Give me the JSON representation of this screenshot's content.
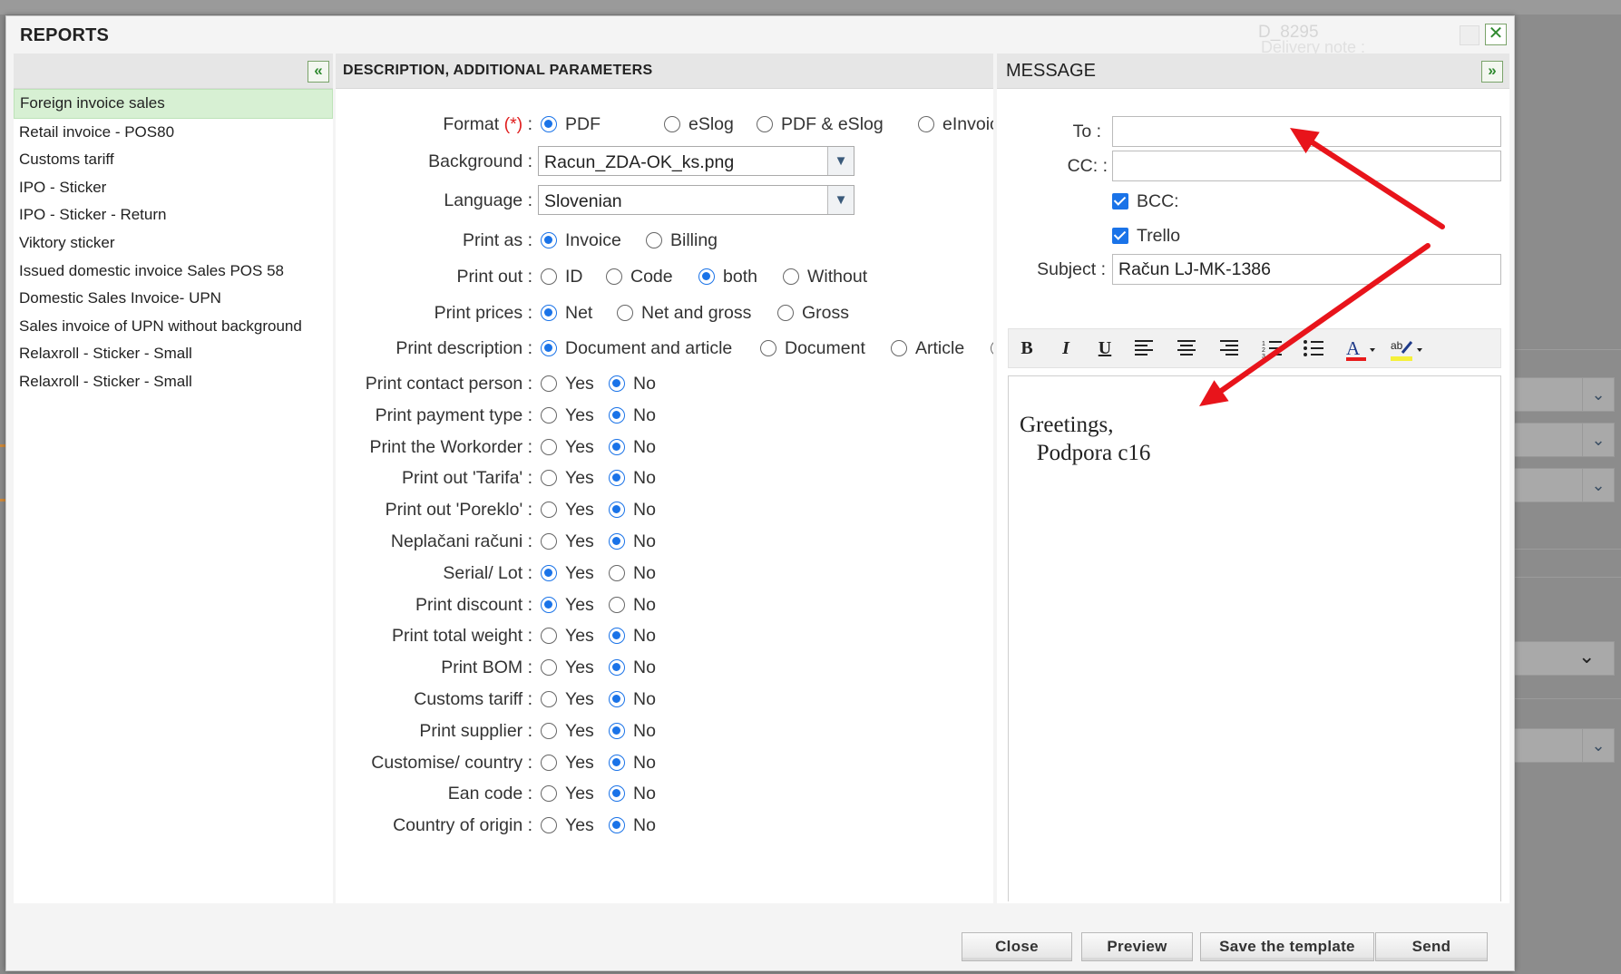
{
  "background_app": {
    "faded_code": "D_8295",
    "faded_label": "Delivery note :"
  },
  "dialog": {
    "title": "REPORTS",
    "close_icon": "close-icon"
  },
  "reports": {
    "items": [
      {
        "label": "Foreign invoice sales",
        "selected": true
      },
      {
        "label": "Retail invoice - POS80"
      },
      {
        "label": "Customs tariff"
      },
      {
        "label": "IPO - Sticker"
      },
      {
        "label": "IPO - Sticker - Return"
      },
      {
        "label": "Viktory sticker"
      },
      {
        "label": "Issued domestic invoice Sales POS 58"
      },
      {
        "label": "Domestic Sales Invoice- UPN"
      },
      {
        "label": "Sales invoice of UPN without background"
      },
      {
        "label": "Relaxroll - Sticker - Small"
      },
      {
        "label": "Relaxroll - Sticker - Small"
      }
    ]
  },
  "params": {
    "header": "DESCRIPTION, ADDITIONAL PARAMETERS",
    "format": {
      "label": "Format",
      "required_mark": "(*)",
      "colon": " :",
      "options": [
        "PDF",
        "eSlog",
        "PDF & eSlog",
        "eInvoic"
      ],
      "selected": "PDF"
    },
    "background": {
      "label": "Background :",
      "value": "Racun_ZDA-OK_ks.png"
    },
    "language": {
      "label": "Language :",
      "value": "Slovenian"
    },
    "print_as": {
      "label": "Print as :",
      "options": [
        "Invoice",
        "Billing"
      ],
      "selected": "Invoice"
    },
    "print_out": {
      "label": "Print out :",
      "options": [
        "ID",
        "Code",
        "both",
        "Without"
      ],
      "selected": "both"
    },
    "print_prices": {
      "label": "Print prices :",
      "options": [
        "Net",
        "Net and gross",
        "Gross"
      ],
      "selected": "Net"
    },
    "print_description": {
      "label": "Print description :",
      "options": [
        "Document and article",
        "Document",
        "Article"
      ],
      "selected": "Document and article"
    },
    "yes": "Yes",
    "no": "No",
    "yes_no_rows": [
      {
        "label": "Print contact person :",
        "value": "No"
      },
      {
        "label": "Print payment type :",
        "value": "No"
      },
      {
        "label": "Print the Workorder :",
        "value": "No"
      },
      {
        "label": "Print out 'Tarifa' :",
        "value": "No"
      },
      {
        "label": "Print out 'Poreklo' :",
        "value": "No"
      },
      {
        "label": "Neplačani računi :",
        "value": "No"
      },
      {
        "label": "Serial/ Lot :",
        "value": "Yes"
      },
      {
        "label": "Print discount :",
        "value": "Yes"
      },
      {
        "label": "Print total weight :",
        "value": "No"
      },
      {
        "label": "Print BOM :",
        "value": "No"
      },
      {
        "label": "Customs tariff :",
        "value": "No"
      },
      {
        "label": "Print supplier :",
        "value": "No"
      },
      {
        "label": "Customise/ country :",
        "value": "No"
      },
      {
        "label": "Ean code :",
        "value": "No"
      },
      {
        "label": "Country of origin :",
        "value": "No"
      }
    ]
  },
  "message": {
    "header": "MESSAGE",
    "to_label": "To :",
    "to_value": "",
    "cc_label": "CC: :",
    "cc_value": "",
    "bcc_label": "BCC:",
    "bcc_checked": true,
    "trello_label": "Trello",
    "trello_checked": true,
    "subject_label": "Subject :",
    "subject_value": "Račun LJ-MK-1386",
    "body": "Greetings,\n   Podpora c16",
    "toolbar": [
      "bold-icon",
      "italic-icon",
      "underline-icon",
      "align-left-icon",
      "align-center-icon",
      "align-right-icon",
      "numbered-list-icon",
      "bullet-list-icon",
      "font-color-icon",
      "highlight-color-icon"
    ]
  },
  "footer": {
    "close": "Close",
    "preview": "Preview",
    "save_template": "Save the template",
    "send": "Send"
  },
  "annotation": {
    "arrow_color": "#e8141b"
  }
}
